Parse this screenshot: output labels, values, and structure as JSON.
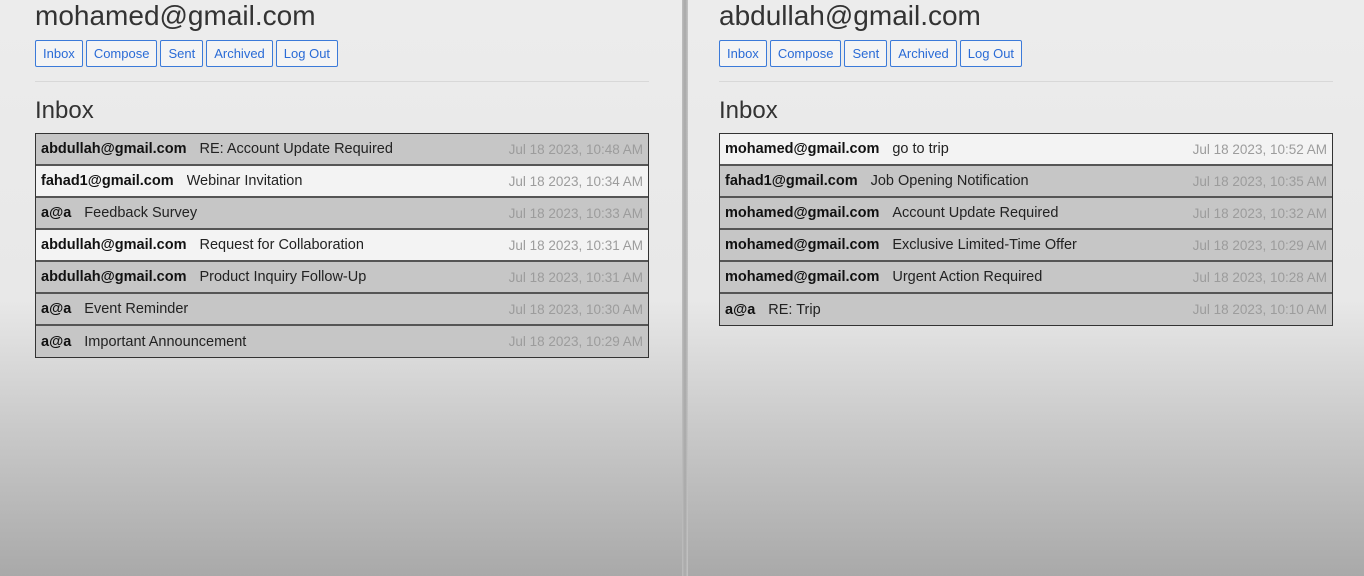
{
  "left": {
    "user_email": "mohamed@gmail.com",
    "nav": {
      "inbox": "Inbox",
      "compose": "Compose",
      "sent": "Sent",
      "archived": "Archived",
      "logout": "Log Out"
    },
    "section_title": "Inbox",
    "emails": [
      {
        "sender": "abdullah@gmail.com",
        "subject": "RE: Account Update Required",
        "timestamp": "Jul 18 2023, 10:48 AM",
        "read": true
      },
      {
        "sender": "fahad1@gmail.com",
        "subject": "Webinar Invitation",
        "timestamp": "Jul 18 2023, 10:34 AM",
        "read": false
      },
      {
        "sender": "a@a",
        "subject": "Feedback Survey",
        "timestamp": "Jul 18 2023, 10:33 AM",
        "read": true
      },
      {
        "sender": "abdullah@gmail.com",
        "subject": "Request for Collaboration",
        "timestamp": "Jul 18 2023, 10:31 AM",
        "read": false
      },
      {
        "sender": "abdullah@gmail.com",
        "subject": "Product Inquiry Follow-Up",
        "timestamp": "Jul 18 2023, 10:31 AM",
        "read": true
      },
      {
        "sender": "a@a",
        "subject": "Event Reminder",
        "timestamp": "Jul 18 2023, 10:30 AM",
        "read": true
      },
      {
        "sender": "a@a",
        "subject": "Important Announcement",
        "timestamp": "Jul 18 2023, 10:29 AM",
        "read": true
      }
    ]
  },
  "right": {
    "user_email": "abdullah@gmail.com",
    "nav": {
      "inbox": "Inbox",
      "compose": "Compose",
      "sent": "Sent",
      "archived": "Archived",
      "logout": "Log Out"
    },
    "section_title": "Inbox",
    "emails": [
      {
        "sender": "mohamed@gmail.com",
        "subject": "go to trip",
        "timestamp": "Jul 18 2023, 10:52 AM",
        "read": false
      },
      {
        "sender": "fahad1@gmail.com",
        "subject": "Job Opening Notification",
        "timestamp": "Jul 18 2023, 10:35 AM",
        "read": true
      },
      {
        "sender": "mohamed@gmail.com",
        "subject": "Account Update Required",
        "timestamp": "Jul 18 2023, 10:32 AM",
        "read": true
      },
      {
        "sender": "mohamed@gmail.com",
        "subject": "Exclusive Limited-Time Offer",
        "timestamp": "Jul 18 2023, 10:29 AM",
        "read": true
      },
      {
        "sender": "mohamed@gmail.com",
        "subject": "Urgent Action Required",
        "timestamp": "Jul 18 2023, 10:28 AM",
        "read": true
      },
      {
        "sender": "a@a",
        "subject": "RE: Trip",
        "timestamp": "Jul 18 2023, 10:10 AM",
        "read": true
      }
    ]
  },
  "colors": {
    "link_blue": "#2a6bd6",
    "read_row": "#c6c6c6",
    "unread_row": "#f3f3f3",
    "timestamp_gray": "#9c9c9c"
  }
}
